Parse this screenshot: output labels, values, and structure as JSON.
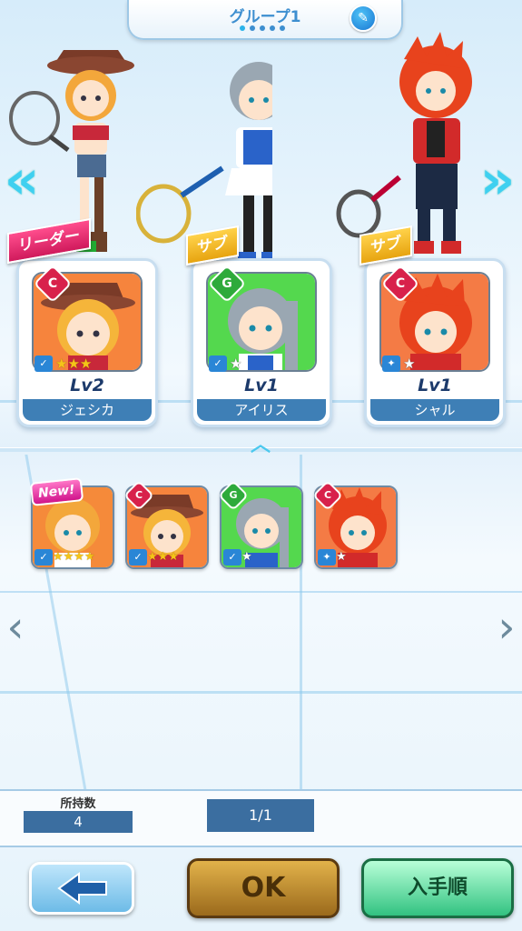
{
  "header": {
    "group_title": "グループ1",
    "page_dots": 5,
    "active_dot": 0
  },
  "team": [
    {
      "role": "リーダー",
      "rarity": "C",
      "level": "Lv2",
      "name": "ジェシカ",
      "stars": 3,
      "star_max": 3,
      "hair": "#f5b53a",
      "bg": "#f6843d"
    },
    {
      "role": "サブ",
      "rarity": "G",
      "level": "Lv1",
      "name": "アイリス",
      "stars": 1,
      "star_max": 1,
      "hair": "#9aa7b2",
      "bg": "#54d84e"
    },
    {
      "role": "サブ",
      "rarity": "C",
      "level": "Lv1",
      "name": "シャル",
      "stars": 1,
      "star_max": 1,
      "hair": "#e8431d",
      "bg": "#f47b45"
    }
  ],
  "collection": [
    {
      "badge": "New!",
      "rarity": "",
      "stars": 4,
      "star_max": 4,
      "hair": "#f3a73b",
      "bg": "#f58a3a"
    },
    {
      "badge": "",
      "rarity": "C",
      "stars": 3,
      "star_max": 3,
      "hair": "#f5b53a",
      "bg": "#f6843d"
    },
    {
      "badge": "",
      "rarity": "G",
      "stars": 1,
      "star_max": 1,
      "hair": "#9aa7b2",
      "bg": "#54d84e"
    },
    {
      "badge": "",
      "rarity": "C",
      "stars": 1,
      "star_max": 1,
      "hair": "#e8431d",
      "bg": "#f47b45"
    }
  ],
  "footer": {
    "owned_label": "所持数",
    "owned_value": "4",
    "page_value": "1/1",
    "ok_label": "OK",
    "sort_label": "入手順"
  },
  "colors": {
    "accent": "#3d8fd0",
    "leader_tag": "#e8216e",
    "sub_tag": "#f2b418",
    "ok": "#b98430",
    "sort": "#3fd58d"
  }
}
